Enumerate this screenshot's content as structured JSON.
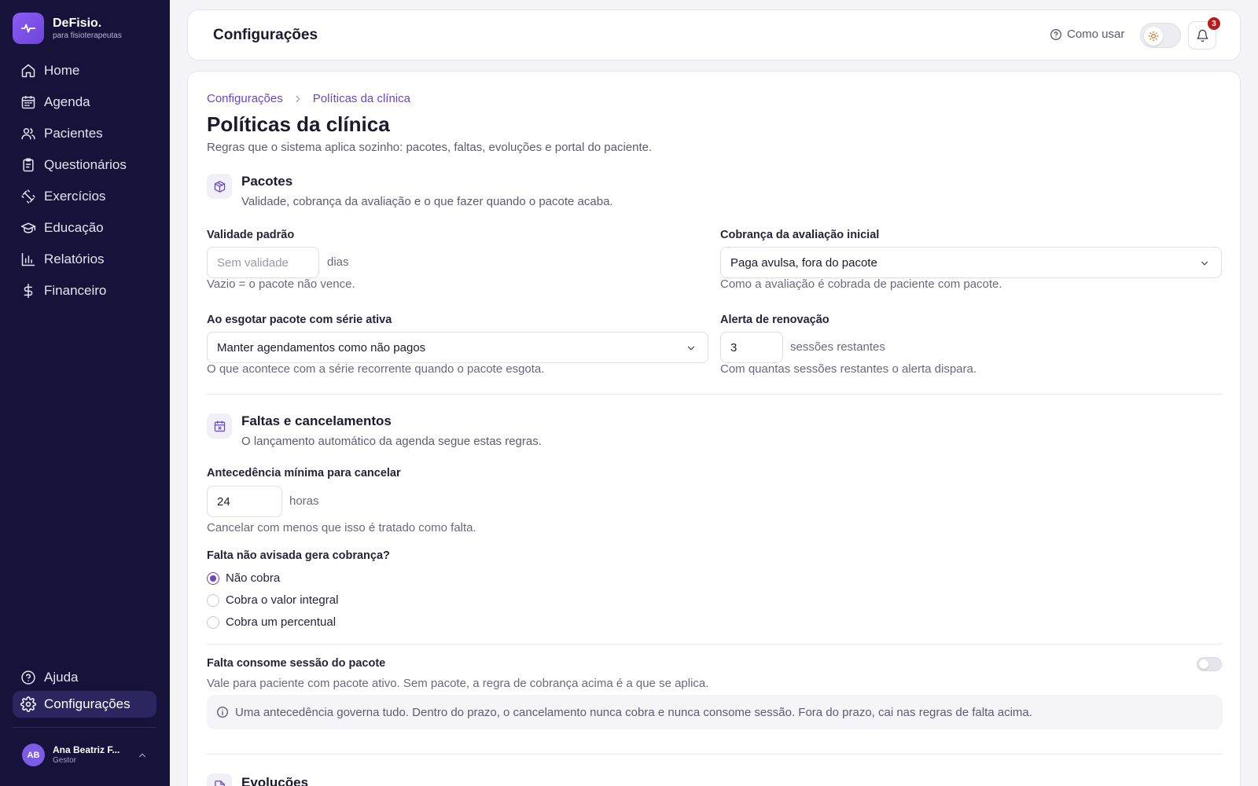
{
  "brand": {
    "name": "DeFisio.",
    "tagline": "para fisioterapeutas"
  },
  "sidebar": {
    "items": [
      {
        "label": "Home",
        "icon": "home-icon"
      },
      {
        "label": "Agenda",
        "icon": "calendar-icon"
      },
      {
        "label": "Pacientes",
        "icon": "users-icon"
      },
      {
        "label": "Questionários",
        "icon": "clipboard-icon"
      },
      {
        "label": "Exercícios",
        "icon": "dumbbell-icon"
      },
      {
        "label": "Educação",
        "icon": "graduation-cap-icon"
      },
      {
        "label": "Relatórios",
        "icon": "bar-chart-icon"
      },
      {
        "label": "Financeiro",
        "icon": "dollar-icon"
      }
    ],
    "bottom": [
      {
        "label": "Ajuda",
        "icon": "help-circle-icon"
      },
      {
        "label": "Configurações",
        "icon": "gear-icon",
        "active": true
      }
    ],
    "user": {
      "initials": "AB",
      "name": "Ana Beatriz F...",
      "role": "Gestor"
    }
  },
  "header": {
    "title": "Configurações",
    "how_to": "Como usar",
    "notifications": "3"
  },
  "breadcrumb": [
    "Configurações",
    "Políticas da clínica"
  ],
  "page": {
    "title": "Políticas da clínica",
    "description": "Regras que o sistema aplica sozinho: pacotes, faltas, evoluções e portal do paciente."
  },
  "packages": {
    "title": "Pacotes",
    "description": "Validade, cobrança da avaliação e o que fazer quando o pacote acaba.",
    "validity": {
      "label": "Validade padrão",
      "placeholder": "Sem validade",
      "suffix": "dias",
      "help": "Vazio = o pacote não vence."
    },
    "eval_billing": {
      "label": "Cobrança da avaliação inicial",
      "value": "Paga avulsa, fora do pacote",
      "help": "Como a avaliação é cobrada de paciente com pacote."
    },
    "on_exhaust": {
      "label": "Ao esgotar pacote com série ativa",
      "value": "Manter agendamentos como não pagos",
      "help": "O que acontece com a série recorrente quando o pacote esgota."
    },
    "renewal_alert": {
      "label": "Alerta de renovação",
      "value": "3",
      "suffix": "sessões restantes",
      "help": "Com quantas sessões restantes o alerta dispara."
    }
  },
  "absences": {
    "title": "Faltas e cancelamentos",
    "description": "O lançamento automático da agenda segue estas regras.",
    "min_notice": {
      "label": "Antecedência mínima para cancelar",
      "value": "24",
      "suffix": "horas",
      "help": "Cancelar com menos que isso é tratado como falta."
    },
    "no_show_charge": {
      "label": "Falta não avisada gera cobrança?",
      "options": [
        "Não cobra",
        "Cobra o valor integral",
        "Cobra um percentual"
      ],
      "selected": "Não cobra"
    },
    "consumes_session": {
      "label": "Falta consome sessão do pacote",
      "help": "Vale para paciente com pacote ativo. Sem pacote, a regra de cobrança acima é a que se aplica.",
      "enabled": false
    },
    "info": "Uma antecedência governa tudo. Dentro do prazo, o cancelamento nunca cobra e nunca consome sessão. Fora do prazo, cai nas regras de falta acima."
  },
  "evolutions": {
    "title": "Evoluções"
  }
}
